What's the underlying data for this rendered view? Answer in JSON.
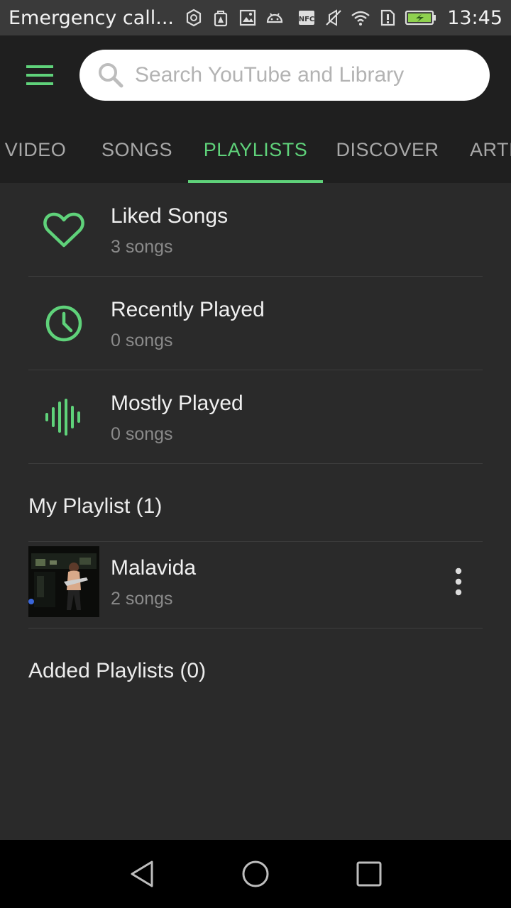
{
  "status_bar": {
    "carrier": "Emergency call...",
    "time": "13:45",
    "battery_color": "#8fd14f",
    "left_icons": [
      "nfc-service-icon",
      "bag-alert-icon",
      "image-icon",
      "android-icon"
    ],
    "right_icons": [
      "nfc-icon",
      "muted-icon",
      "wifi-icon",
      "sim-alert-icon",
      "battery-icon"
    ]
  },
  "colors": {
    "accent": "#5fd27a",
    "background": "#2a2a2a",
    "appbar": "#1f1f1f"
  },
  "header": {
    "menu_icon": "hamburger-menu-icon",
    "search_placeholder": "Search YouTube and Library"
  },
  "tabs": [
    {
      "label": "VIDEO"
    },
    {
      "label": "SONGS"
    },
    {
      "label": "PLAYLISTS",
      "active": true
    },
    {
      "label": "DISCOVER"
    },
    {
      "label": "ARTI"
    }
  ],
  "smart_playlists": [
    {
      "icon": "heart-icon",
      "title": "Liked Songs",
      "count": "3 songs"
    },
    {
      "icon": "clock-icon",
      "title": "Recently Played",
      "count": "0 songs"
    },
    {
      "icon": "sound-wave-icon",
      "title": "Mostly Played",
      "count": "0 songs"
    }
  ],
  "my_playlist": {
    "heading": "My Playlist (1)",
    "items": [
      {
        "title": "Malavida",
        "count": "2 songs",
        "thumb_icon": "album-art-thumbnail",
        "more_icon": "more-vert-icon"
      }
    ]
  },
  "added_playlists": {
    "heading": "Added Playlists (0)"
  },
  "nav_bar": {
    "icons": [
      "back-icon",
      "home-icon",
      "recents-icon"
    ]
  }
}
